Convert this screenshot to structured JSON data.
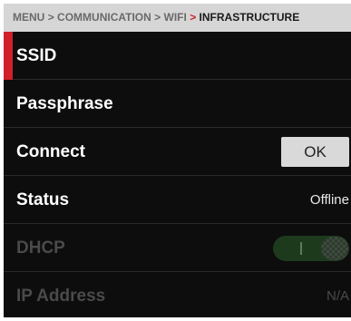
{
  "breadcrumb": {
    "items": [
      "MENU",
      "COMMUNICATION",
      "WIFI"
    ],
    "current": "INFRASTRUCTURE",
    "separator": ">"
  },
  "menu": {
    "ssid": {
      "label": "SSID"
    },
    "passphrase": {
      "label": "Passphrase"
    },
    "connect": {
      "label": "Connect",
      "button_label": "OK"
    },
    "status": {
      "label": "Status",
      "value": "Offline"
    },
    "dhcp": {
      "label": "DHCP",
      "state": "on",
      "enabled": false
    },
    "ip_address": {
      "label": "IP Address",
      "value": "N/A"
    }
  },
  "colors": {
    "accent": "#d0202a",
    "background": "#0d0d0d",
    "breadcrumb_bg": "#d6d6d6",
    "disabled_text": "#4a4a4a",
    "toggle_on": "#1d3a1d"
  }
}
